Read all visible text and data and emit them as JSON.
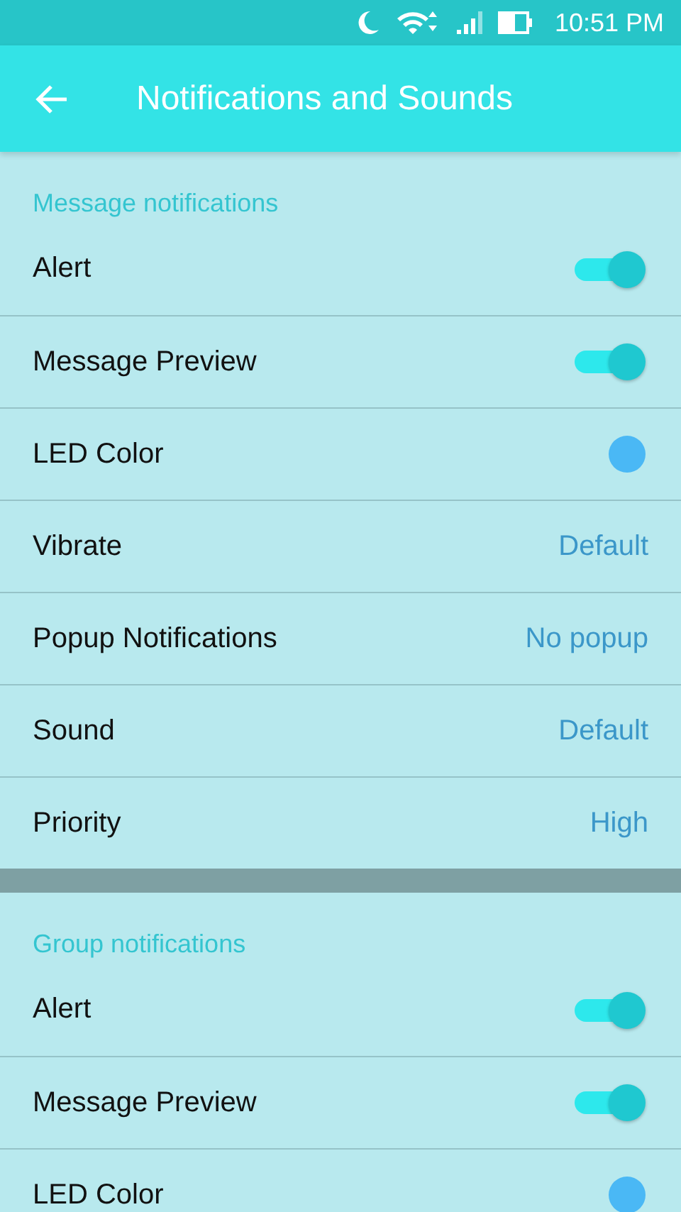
{
  "status_bar": {
    "time": "10:51 PM"
  },
  "app_bar": {
    "title": "Notifications and Sounds"
  },
  "sections": [
    {
      "title": "Message notifications",
      "rows": [
        {
          "kind": "toggle",
          "label": "Alert",
          "on": true
        },
        {
          "kind": "toggle",
          "label": "Message Preview",
          "on": true
        },
        {
          "kind": "color",
          "label": "LED Color",
          "color": "#4ab8f5"
        },
        {
          "kind": "value",
          "label": "Vibrate",
          "value": "Default"
        },
        {
          "kind": "value",
          "label": "Popup Notifications",
          "value": "No popup"
        },
        {
          "kind": "value",
          "label": "Sound",
          "value": "Default"
        },
        {
          "kind": "value",
          "label": "Priority",
          "value": "High"
        }
      ]
    },
    {
      "title": "Group notifications",
      "rows": [
        {
          "kind": "toggle",
          "label": "Alert",
          "on": true
        },
        {
          "kind": "toggle",
          "label": "Message Preview",
          "on": true
        },
        {
          "kind": "color",
          "label": "LED Color",
          "color": "#4ab8f5"
        }
      ]
    }
  ]
}
